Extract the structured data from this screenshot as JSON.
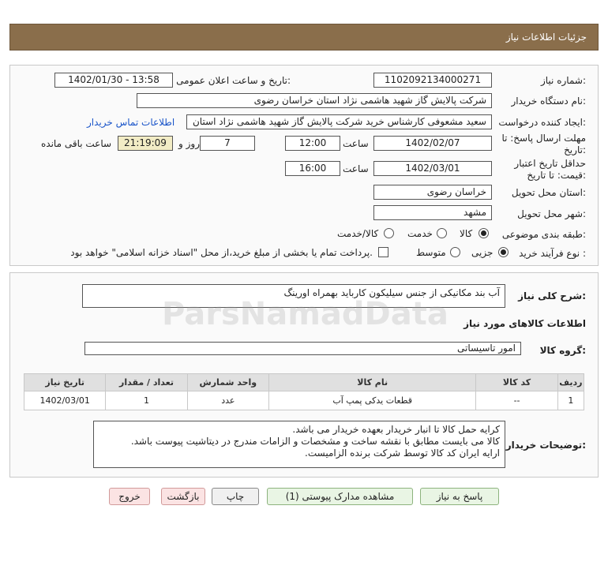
{
  "header": {
    "title": "جزئیات اطلاعات نیاز"
  },
  "form": {
    "need_number_label": "شماره نیاز:",
    "need_number": "1102092134000271",
    "announce_label": "تاریخ و ساعت اعلان عمومی:",
    "announce_value": "1402/01/30 - 13:58",
    "buyer_org_label": "نام دستگاه خریدار:",
    "buyer_org": "شرکت پالایش گاز شهید هاشمی نژاد   استان خراسان رضوی",
    "creator_label": "ایجاد کننده درخواست:",
    "creator": "سعید مشعوفی کارشناس خرید شرکت پالایش گاز شهید هاشمی نژاد   استان",
    "contact_link": "اطلاعات تماس خریدار",
    "deadline_label_1": "مهلت ارسال پاسخ: تا",
    "deadline_label_2": "تاریخ:",
    "deadline_date": "1402/02/07",
    "time_label": "ساعت",
    "deadline_time": "12:00",
    "days_value": "7",
    "days_label": "روز و",
    "remaining_time": "21:19:09",
    "remaining_label": "ساعت باقی مانده",
    "validity_label_1": "حداقل تاریخ اعتبار",
    "validity_label_2": "قیمت: تا تاریخ:",
    "validity_date": "1402/03/01",
    "validity_time": "16:00",
    "province_label": "استان محل تحویل:",
    "province": "خراسان رضوی",
    "city_label": "شهر محل تحویل:",
    "city": "مشهد",
    "category_label": "طبقه بندی موضوعی:",
    "category_options": [
      "کالا",
      "خدمت",
      "کالا/خدمت"
    ],
    "process_label": "نوع فرآیند خرید :",
    "process_options": [
      "جزیی",
      "متوسط"
    ],
    "payment_note": "پرداخت تمام یا بخشی از مبلغ خرید،از محل \"اسناد خزانه اسلامی\" خواهد بود."
  },
  "details": {
    "summary_label": "شرح کلی نیاز:",
    "summary": "آب بند مکانیکی از جنس سیلیکون کارباید بهمراه اورینگ",
    "goods_info_label": "اطلاعات کالاهای مورد نیاز",
    "goods_group_label": "گروه کالا:",
    "goods_group": "امور تاسیساتی",
    "table": {
      "headers": [
        "ردیف",
        "کد کالا",
        "نام کالا",
        "واحد شمارش",
        "تعداد / مقدار",
        "تاریخ نیاز"
      ],
      "rows": [
        [
          "1",
          "--",
          "قطعات یدکی پمپ آب",
          "عدد",
          "1",
          "1402/03/01"
        ]
      ]
    },
    "buyer_notes_label": "توضیحات خریدار:",
    "buyer_notes": [
      "کرایه حمل کالا تا انبار خریدار بعهده خریدار می باشد.",
      "کالا می بایست مطابق با نقشه ساخت و مشخصات و الزامات مندرج در دیتاشیت پیوست باشد.",
      "ارایه ایران کد کالا توسط شرکت برنده الزامیست."
    ]
  },
  "buttons": {
    "reply": "پاسخ به نیاز",
    "view_docs": "مشاهده مدارک پیوستی (1)",
    "print": "چاپ",
    "back": "بازگشت",
    "exit": "خروج"
  },
  "watermark": {
    "brand": "ParsNamadData"
  }
}
